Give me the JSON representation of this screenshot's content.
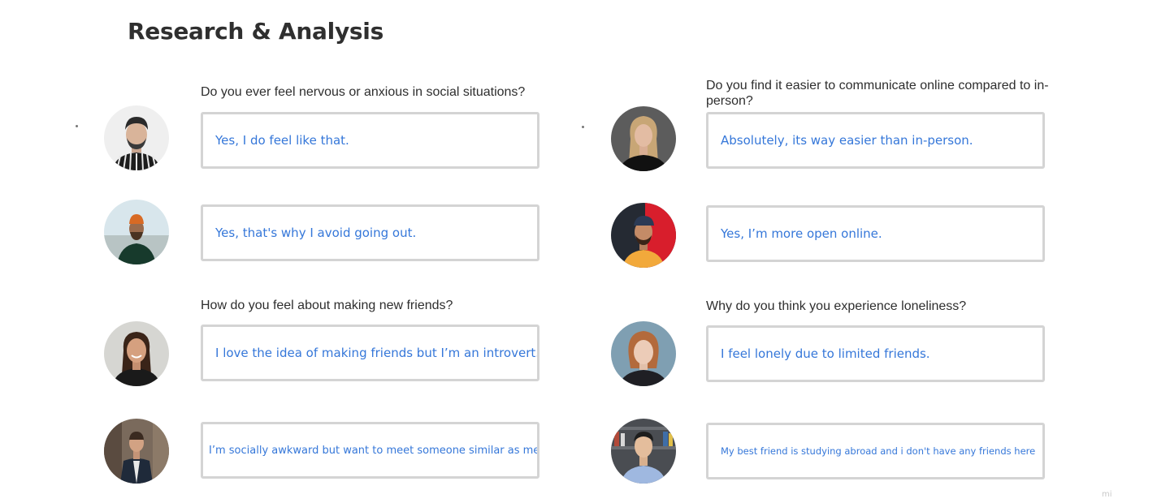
{
  "title": "Research & Analysis",
  "left": {
    "questions": [
      "Do you ever feel nervous or anxious in social situations?",
      "How do you feel about making new friends?"
    ],
    "answers": [
      "Yes, I do feel like that.",
      "Yes, that's why I avoid going out.",
      "I love the idea of making friends but I’m an introvert.",
      "I’m socially awkward but want to meet someone similar as me"
    ]
  },
  "right": {
    "questions": [
      "Do you find it easier to communicate online compared to in-person?",
      "Why do you think you experience loneliness?"
    ],
    "answers": [
      "Absolutely, its way easier than in-person.",
      "Yes, I’m more open online.",
      "I feel lonely due to limited friends.",
      "My best friend is studying abroad and i don't have any friends here"
    ]
  },
  "watermark": "mi",
  "colors": {
    "answer_text": "#3577d9",
    "box_border": "#d4d4d4",
    "title": "#2f2f2f"
  }
}
